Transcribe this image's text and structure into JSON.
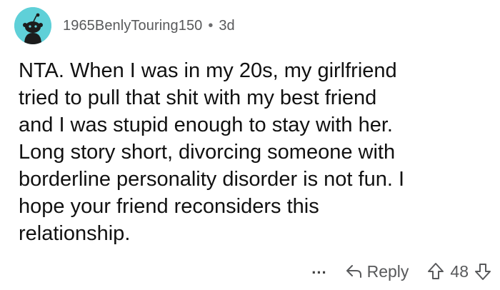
{
  "comment": {
    "author": "1965BenlyTouring150",
    "separator": "•",
    "age": "3d",
    "lines": [
      "NTA. When I was in my 20s, my girlfriend",
      "tried to pull that shit with my best friend",
      "and I was stupid enough to stay with her.",
      "Long story short, divorcing someone with",
      "borderline personality disorder is not fun. I",
      "hope your friend reconsiders this",
      "relationship."
    ]
  },
  "actions": {
    "more_label": "...",
    "reply_label": "Reply",
    "score": "48"
  },
  "icons": {
    "avatar": "reddit-snoo-avatar-icon",
    "reply": "reply-arrow-icon",
    "upvote": "upvote-arrow-icon",
    "downvote": "downvote-arrow-icon"
  },
  "colors": {
    "avatar_bg": "#5fd0d8",
    "meta_text": "#58595b",
    "body_text": "#111111"
  }
}
